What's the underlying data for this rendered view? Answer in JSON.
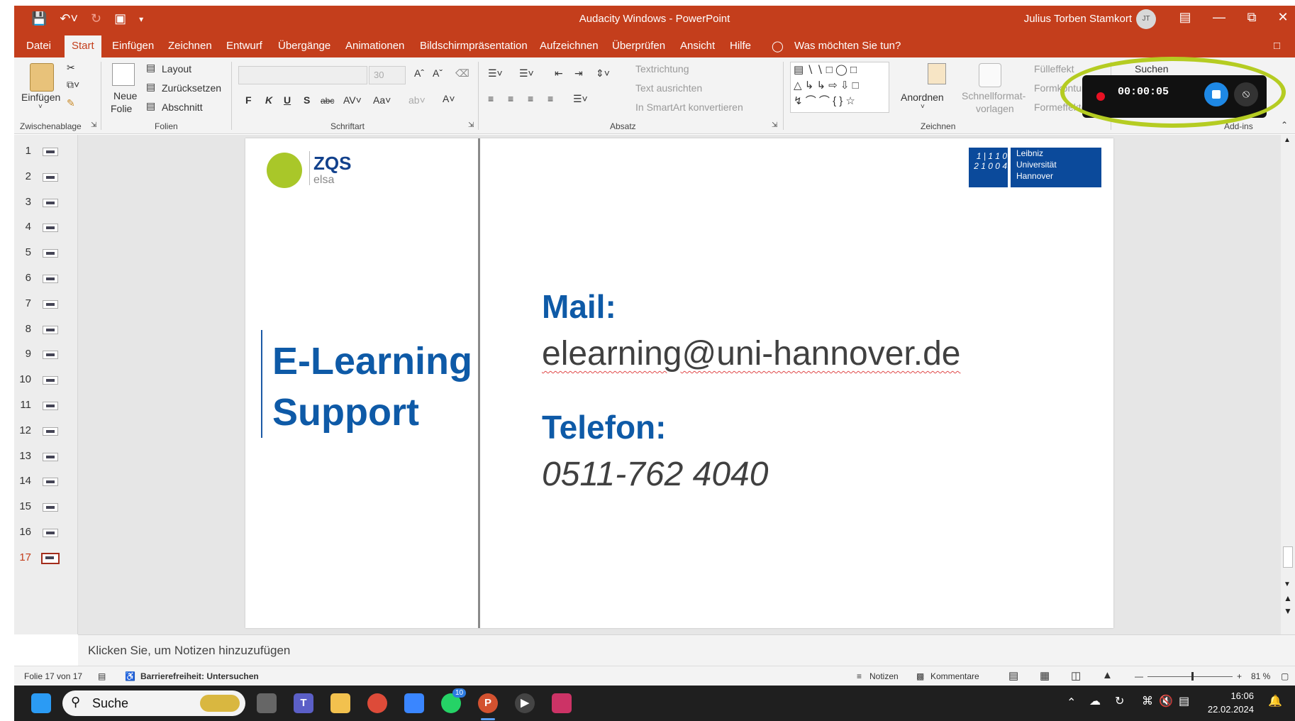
{
  "window": {
    "title": "Audacity Windows  -  PowerPoint",
    "user": "Julius Torben Stamkort",
    "user_initials": "JT"
  },
  "tabs": [
    "Datei",
    "Start",
    "Einfügen",
    "Zeichnen",
    "Entwurf",
    "Übergänge",
    "Animationen",
    "Bildschirmpräsentation",
    "Aufzeichnen",
    "Überprüfen",
    "Ansicht",
    "Hilfe"
  ],
  "tell_me": "Was möchten Sie tun?",
  "ribbon": {
    "paste": "Einfügen",
    "new_slide_1": "Neue",
    "new_slide_2": "Folie",
    "layout": "Layout",
    "reset": "Zurücksetzen",
    "section": "Abschnitt",
    "font_size": "30",
    "text_direction": "Textrichtung",
    "align_text": "Text ausrichten",
    "smartart": "In SmartArt konvertieren",
    "arrange": "Anordnen",
    "quick_styles_1": "Schnellformat-",
    "quick_styles_2": "vorlagen",
    "fill": "Fülleffekt",
    "outline": "Formkontur",
    "effects": "Formeffekte",
    "search": "Suchen",
    "addins": "Add-ins",
    "groups": {
      "clipboard": "Zwischenablage",
      "slides": "Folien",
      "font": "Schriftart",
      "paragraph": "Absatz",
      "drawing": "Zeichnen"
    }
  },
  "recorder": {
    "time": "00:00:05"
  },
  "thumbnails": [
    "1",
    "2",
    "3",
    "4",
    "5",
    "6",
    "7",
    "8",
    "9",
    "10",
    "11",
    "12",
    "13",
    "14",
    "15",
    "16",
    "17"
  ],
  "slide": {
    "zqs": "ZQS",
    "zqs_sub": "elsa",
    "luh_digits": "1 | 1 1 0 2 1 0 0 4",
    "luh_1": "Leibniz",
    "luh_2": "Universität",
    "luh_3": "Hannover",
    "title_1": "E-Learning",
    "title_2": "Support",
    "mail_label": "Mail:",
    "mail_value": "elearning@uni-hannover.de",
    "phone_label": "Telefon:",
    "phone_value": "0511-762 4040"
  },
  "notes_placeholder": "Klicken Sie, um Notizen hinzuzufügen",
  "status": {
    "slide_count": "Folie 17 von 17",
    "accessibility": "Barrierefreiheit: Untersuchen",
    "notes": "Notizen",
    "comments": "Kommentare",
    "zoom": "81 %"
  },
  "taskbar": {
    "search": "Suche",
    "whatsapp_badge": "10",
    "time": "16:06",
    "date": "22.02.2024"
  },
  "colors": {
    "accent": "#c43e1c",
    "slide_blue": "#0e5aa7",
    "highlight": "#b5cc22"
  }
}
